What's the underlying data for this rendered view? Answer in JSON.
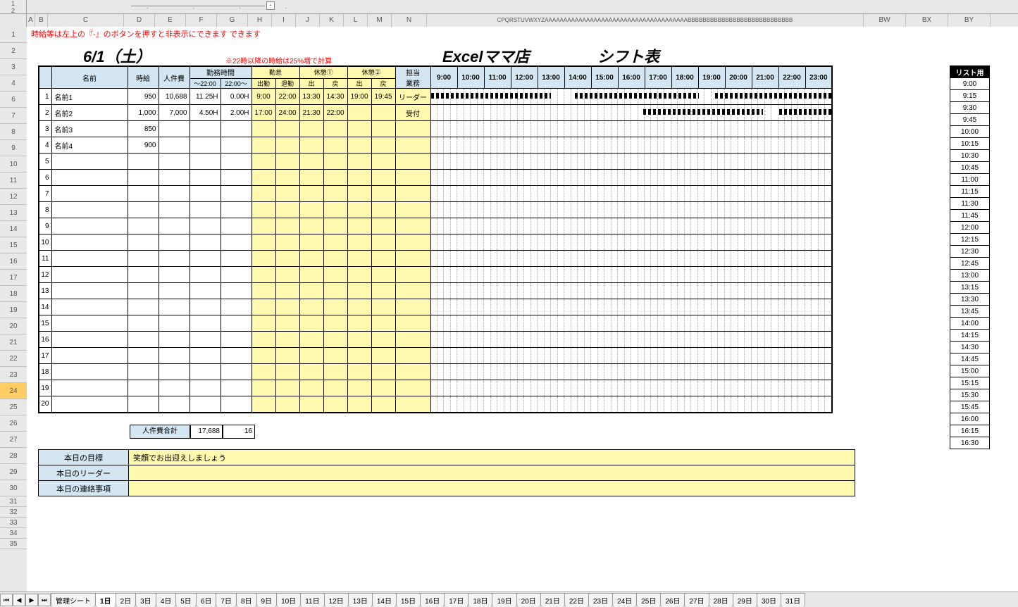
{
  "hint1": "時給等は左上の『-』のボタンを押すと非表示にできます できます",
  "hint2": "※22時以降の時給は25%増で計算",
  "date_title": "6/1（土）",
  "store_name": "Excelママ店",
  "sheet_title": "シフト表",
  "headers": {
    "name": "名前",
    "wage": "時給",
    "labor": "人件費",
    "worktime": "勤務時間",
    "worktime_sub1": "～22:00",
    "worktime_sub2": "22:00～",
    "attend": "勤怠",
    "attend_sub1": "出勤",
    "attend_sub2": "退勤",
    "break1": "休憩①",
    "break2": "休憩②",
    "break_sub1": "出",
    "break_sub2": "戻",
    "role": "担当\n業務"
  },
  "hours": [
    "9:00",
    "10:00",
    "11:00",
    "12:00",
    "13:00",
    "14:00",
    "15:00",
    "16:00",
    "17:00",
    "18:00",
    "19:00",
    "20:00",
    "21:00",
    "22:00",
    "23:00"
  ],
  "rows": [
    {
      "no": "1",
      "name": "名前1",
      "wage": "950",
      "labor": "10,688",
      "wt1": "11.25H",
      "wt2": "0.00H",
      "in": "9:00",
      "out": "22:00",
      "b1a": "13:30",
      "b1b": "14:30",
      "b2a": "19:00",
      "b2b": "19:45",
      "role": "リーダー",
      "segs": [
        [
          0,
          30
        ],
        [
          36,
          67
        ],
        [
          71,
          100
        ]
      ]
    },
    {
      "no": "2",
      "name": "名前2",
      "wage": "1,000",
      "labor": "7,000",
      "wt1": "4.50H",
      "wt2": "2.00H",
      "in": "17:00",
      "out": "24:00",
      "b1a": "21:30",
      "b1b": "22:00",
      "b2a": "",
      "b2b": "",
      "role": "受付",
      "segs": [
        [
          53,
          83
        ],
        [
          87,
          100
        ]
      ]
    },
    {
      "no": "3",
      "name": "名前3",
      "wage": "850",
      "labor": "",
      "wt1": "",
      "wt2": "",
      "in": "",
      "out": "",
      "b1a": "",
      "b1b": "",
      "b2a": "",
      "b2b": "",
      "role": "",
      "segs": []
    },
    {
      "no": "4",
      "name": "名前4",
      "wage": "900",
      "labor": "",
      "wt1": "",
      "wt2": "",
      "in": "",
      "out": "",
      "b1a": "",
      "b1b": "",
      "b2a": "",
      "b2b": "",
      "role": "",
      "segs": []
    },
    {
      "no": "5"
    },
    {
      "no": "6"
    },
    {
      "no": "7"
    },
    {
      "no": "8"
    },
    {
      "no": "9"
    },
    {
      "no": "10"
    },
    {
      "no": "11"
    },
    {
      "no": "12"
    },
    {
      "no": "13"
    },
    {
      "no": "14"
    },
    {
      "no": "15"
    },
    {
      "no": "16"
    },
    {
      "no": "17"
    },
    {
      "no": "18"
    },
    {
      "no": "19"
    },
    {
      "no": "20"
    }
  ],
  "total": {
    "label": "人件費合計",
    "sum": "17,688",
    "count": "16"
  },
  "footer": [
    {
      "label": "本日の目標",
      "value": "笑顔でお出迎えしましょう"
    },
    {
      "label": "本日のリーダー",
      "value": ""
    },
    {
      "label": "本日の連絡事項",
      "value": ""
    }
  ],
  "list_header": "リスト用",
  "list_times": [
    "9:00",
    "9:15",
    "9:30",
    "9:45",
    "10:00",
    "10:15",
    "10:30",
    "10:45",
    "11:00",
    "11:15",
    "11:30",
    "11:45",
    "12:00",
    "12:15",
    "12:30",
    "12:45",
    "13:00",
    "13:15",
    "13:30",
    "13:45",
    "14:00",
    "14:15",
    "14:30",
    "14:45",
    "15:00",
    "15:15",
    "15:30",
    "15:45",
    "16:00",
    "16:15",
    "16:30"
  ],
  "col_letters": [
    "A",
    "B",
    "C",
    "D",
    "E",
    "F",
    "G",
    "H",
    "I",
    "J",
    "K",
    "L",
    "M",
    "N"
  ],
  "col_tail": "CPQRSTUVWXYZAAAAAAAAAAAAAAAAAAAAAAAAAAAAAAAAAAAAAABBBBBBBBBBBBBBBBBBBBBBBBBBBB",
  "col_extra": [
    "BW",
    "BX",
    "BY"
  ],
  "row_numbers": [
    "1",
    "2",
    "3",
    "4",
    "6",
    "7",
    "8",
    "9",
    "10",
    "11",
    "12",
    "13",
    "14",
    "15",
    "16",
    "17",
    "18",
    "19",
    "20",
    "21",
    "22",
    "23",
    "24",
    "25",
    "26",
    "27",
    "28",
    "29",
    "30",
    "31",
    "32",
    "33",
    "34",
    "35"
  ],
  "sheet_tabs": [
    "管理シート",
    "1日",
    "2日",
    "3日",
    "4日",
    "5日",
    "6日",
    "7日",
    "8日",
    "9日",
    "10日",
    "11日",
    "12日",
    "13日",
    "14日",
    "15日",
    "16日",
    "17日",
    "18日",
    "19日",
    "20日",
    "21日",
    "22日",
    "23日",
    "24日",
    "25日",
    "26日",
    "27日",
    "28日",
    "29日",
    "30日",
    "31日"
  ],
  "nav_icons": [
    "⏮",
    "◀",
    "▶",
    "⏭"
  ]
}
